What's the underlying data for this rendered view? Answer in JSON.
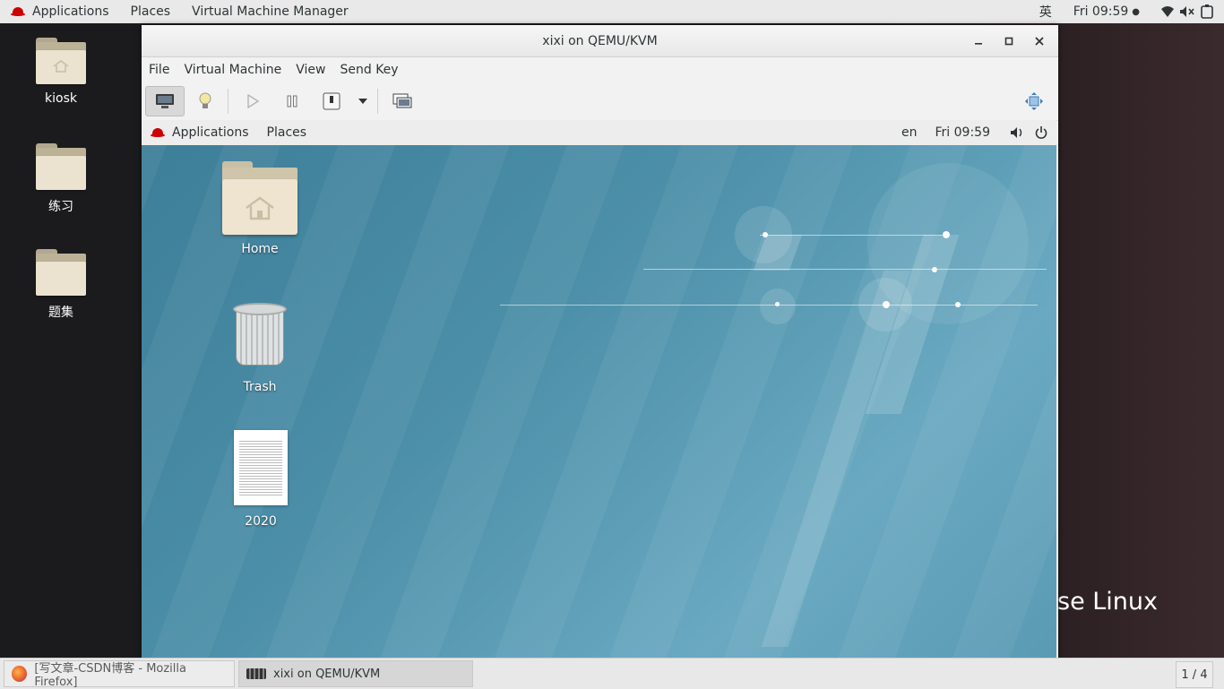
{
  "host_topbar": {
    "applications": "Applications",
    "places": "Places",
    "vmm": "Virtual Machine Manager",
    "input_method": "英",
    "clock": "Fri 09:59",
    "clock_dot": "●"
  },
  "host_desktop": {
    "icons": [
      {
        "label": "kiosk"
      },
      {
        "label": "练习"
      },
      {
        "label": "题集"
      }
    ],
    "brand_fragment": "se Linux"
  },
  "vm_window": {
    "title": "xixi on QEMU/KVM",
    "menu": [
      "File",
      "Virtual Machine",
      "View",
      "Send Key"
    ],
    "toolbar": {
      "console": "console-icon",
      "details": "bulb-icon",
      "run": "play-icon",
      "pause": "pause-icon",
      "shutdown": "power-icon",
      "shutdown_menu": "chevron-down-icon",
      "snapshots": "snapshot-icon",
      "fullscreen": "fullscreen-icon"
    }
  },
  "guest": {
    "topbar": {
      "applications": "Applications",
      "places": "Places",
      "lang": "en",
      "clock": "Fri 09:59"
    },
    "icons": [
      {
        "label": "Home"
      },
      {
        "label": "Trash"
      },
      {
        "label": "2020"
      }
    ]
  },
  "taskbar": {
    "tasks": [
      {
        "label": "[写文章-CSDN博客 - Mozilla Firefox]"
      },
      {
        "label": "xixi on QEMU/KVM"
      }
    ],
    "workspace": "1 / 4"
  },
  "colors": {
    "guest_bg": "#4c8fa8",
    "redhat_red": "#cc0000"
  }
}
